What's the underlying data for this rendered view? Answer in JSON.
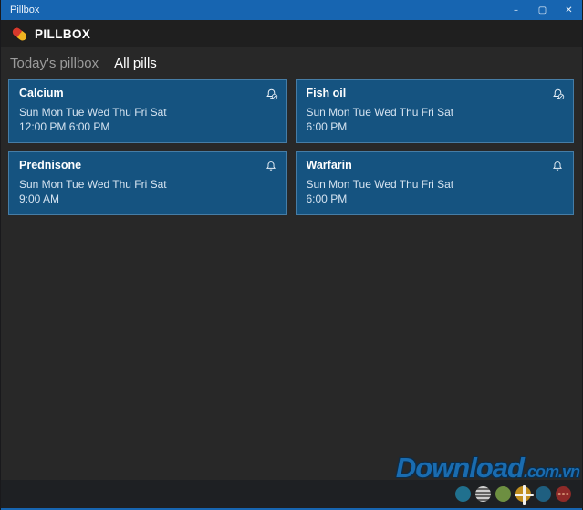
{
  "window": {
    "title": "Pillbox",
    "controls": {
      "minimize": "–",
      "maximize": "▢",
      "close": "✕"
    }
  },
  "header": {
    "app_name": "PILLBOX",
    "pill_icon_colors": [
      "#d6392c",
      "#f0b321"
    ]
  },
  "tabs": [
    {
      "label": "Today's pillbox",
      "active": false
    },
    {
      "label": "All pills",
      "active": true
    }
  ],
  "pills": [
    {
      "name": "Calcium",
      "days": "Sun Mon Tue Wed Thu Fri Sat",
      "times": "12:00 PM 6:00 PM",
      "reminder": "off"
    },
    {
      "name": "Fish oil",
      "days": "Sun Mon Tue Wed Thu Fri Sat",
      "times": "6:00 PM",
      "reminder": "off"
    },
    {
      "name": "Prednisone",
      "days": "Sun Mon Tue Wed Thu Fri Sat",
      "times": "9:00 AM",
      "reminder": "on"
    },
    {
      "name": "Warfarin",
      "days": "Sun Mon Tue Wed Thu Fri Sat",
      "times": "6:00 PM",
      "reminder": "on"
    }
  ],
  "appbar": {
    "buttons": [
      {
        "name": "dot-teal",
        "color": "#20708e"
      },
      {
        "name": "list-view",
        "color": "#a8a8a8"
      },
      {
        "name": "dot-green",
        "color": "#6d8f41"
      },
      {
        "name": "add-pill",
        "color": "#c08e1f",
        "glyph": "plus"
      },
      {
        "name": "dot-teal-2",
        "color": "#1f5f80"
      },
      {
        "name": "more",
        "color": "#8e2a28",
        "glyph": "ellipsis"
      }
    ]
  },
  "watermark": {
    "main": "Download",
    "suffix": ".com.vn"
  },
  "colors": {
    "titlebar": "#1765b1",
    "header_bg": "#1f1f1f",
    "content_bg": "#282828",
    "card_bg": "#155380",
    "appbar_bg": "#1e2023",
    "watermark_blue": "#1a6cb0"
  }
}
